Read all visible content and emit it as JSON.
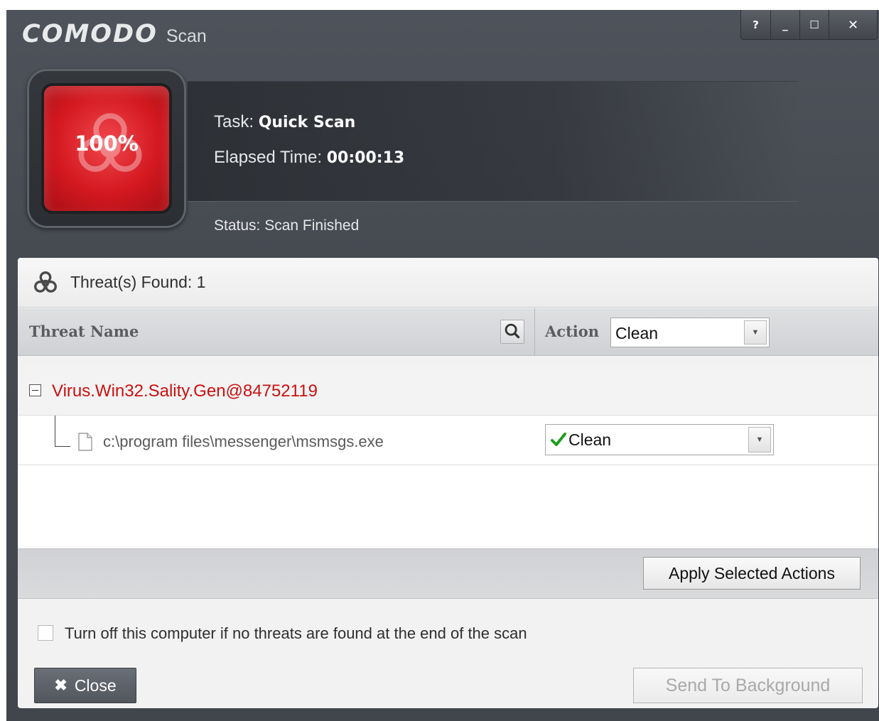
{
  "window": {
    "brand": "COMODO",
    "title": "Scan",
    "controls": {
      "help": "?",
      "minimize": "_",
      "maximize": "☐",
      "close": "✕"
    }
  },
  "progress": {
    "percent_label": "100%",
    "percent": 100,
    "color": "#d41820"
  },
  "task": {
    "task_label": "Task:",
    "task_value": "Quick Scan",
    "elapsed_label": "Elapsed Time:",
    "elapsed_value": "00:00:13",
    "status": "Status: Scan Finished"
  },
  "results": {
    "threats_found": "Threat(s) Found: 1",
    "columns": {
      "threat_name": "Threat Name",
      "action": "Action"
    },
    "global_action": "Clean",
    "threats": [
      {
        "name": "Virus.Win32.Sality.Gen@84752119",
        "files": [
          {
            "path": "c:\\program files\\messenger\\msmsgs.exe",
            "action": "Clean"
          }
        ]
      }
    ]
  },
  "buttons": {
    "apply": "Apply Selected Actions",
    "close": "Close",
    "close_icon": "✖",
    "send_to_background": "Send To Background"
  },
  "options": {
    "shutdown_label": "Turn off this computer if no threats are found at the end of the scan",
    "shutdown_checked": false
  },
  "colors": {
    "threat_red": "#cc1010",
    "check_green": "#1e9e1e"
  },
  "icons": [
    "biohazard-icon",
    "search-icon",
    "file-icon",
    "checkmark-icon",
    "chevron-down-icon",
    "close-icon"
  ]
}
